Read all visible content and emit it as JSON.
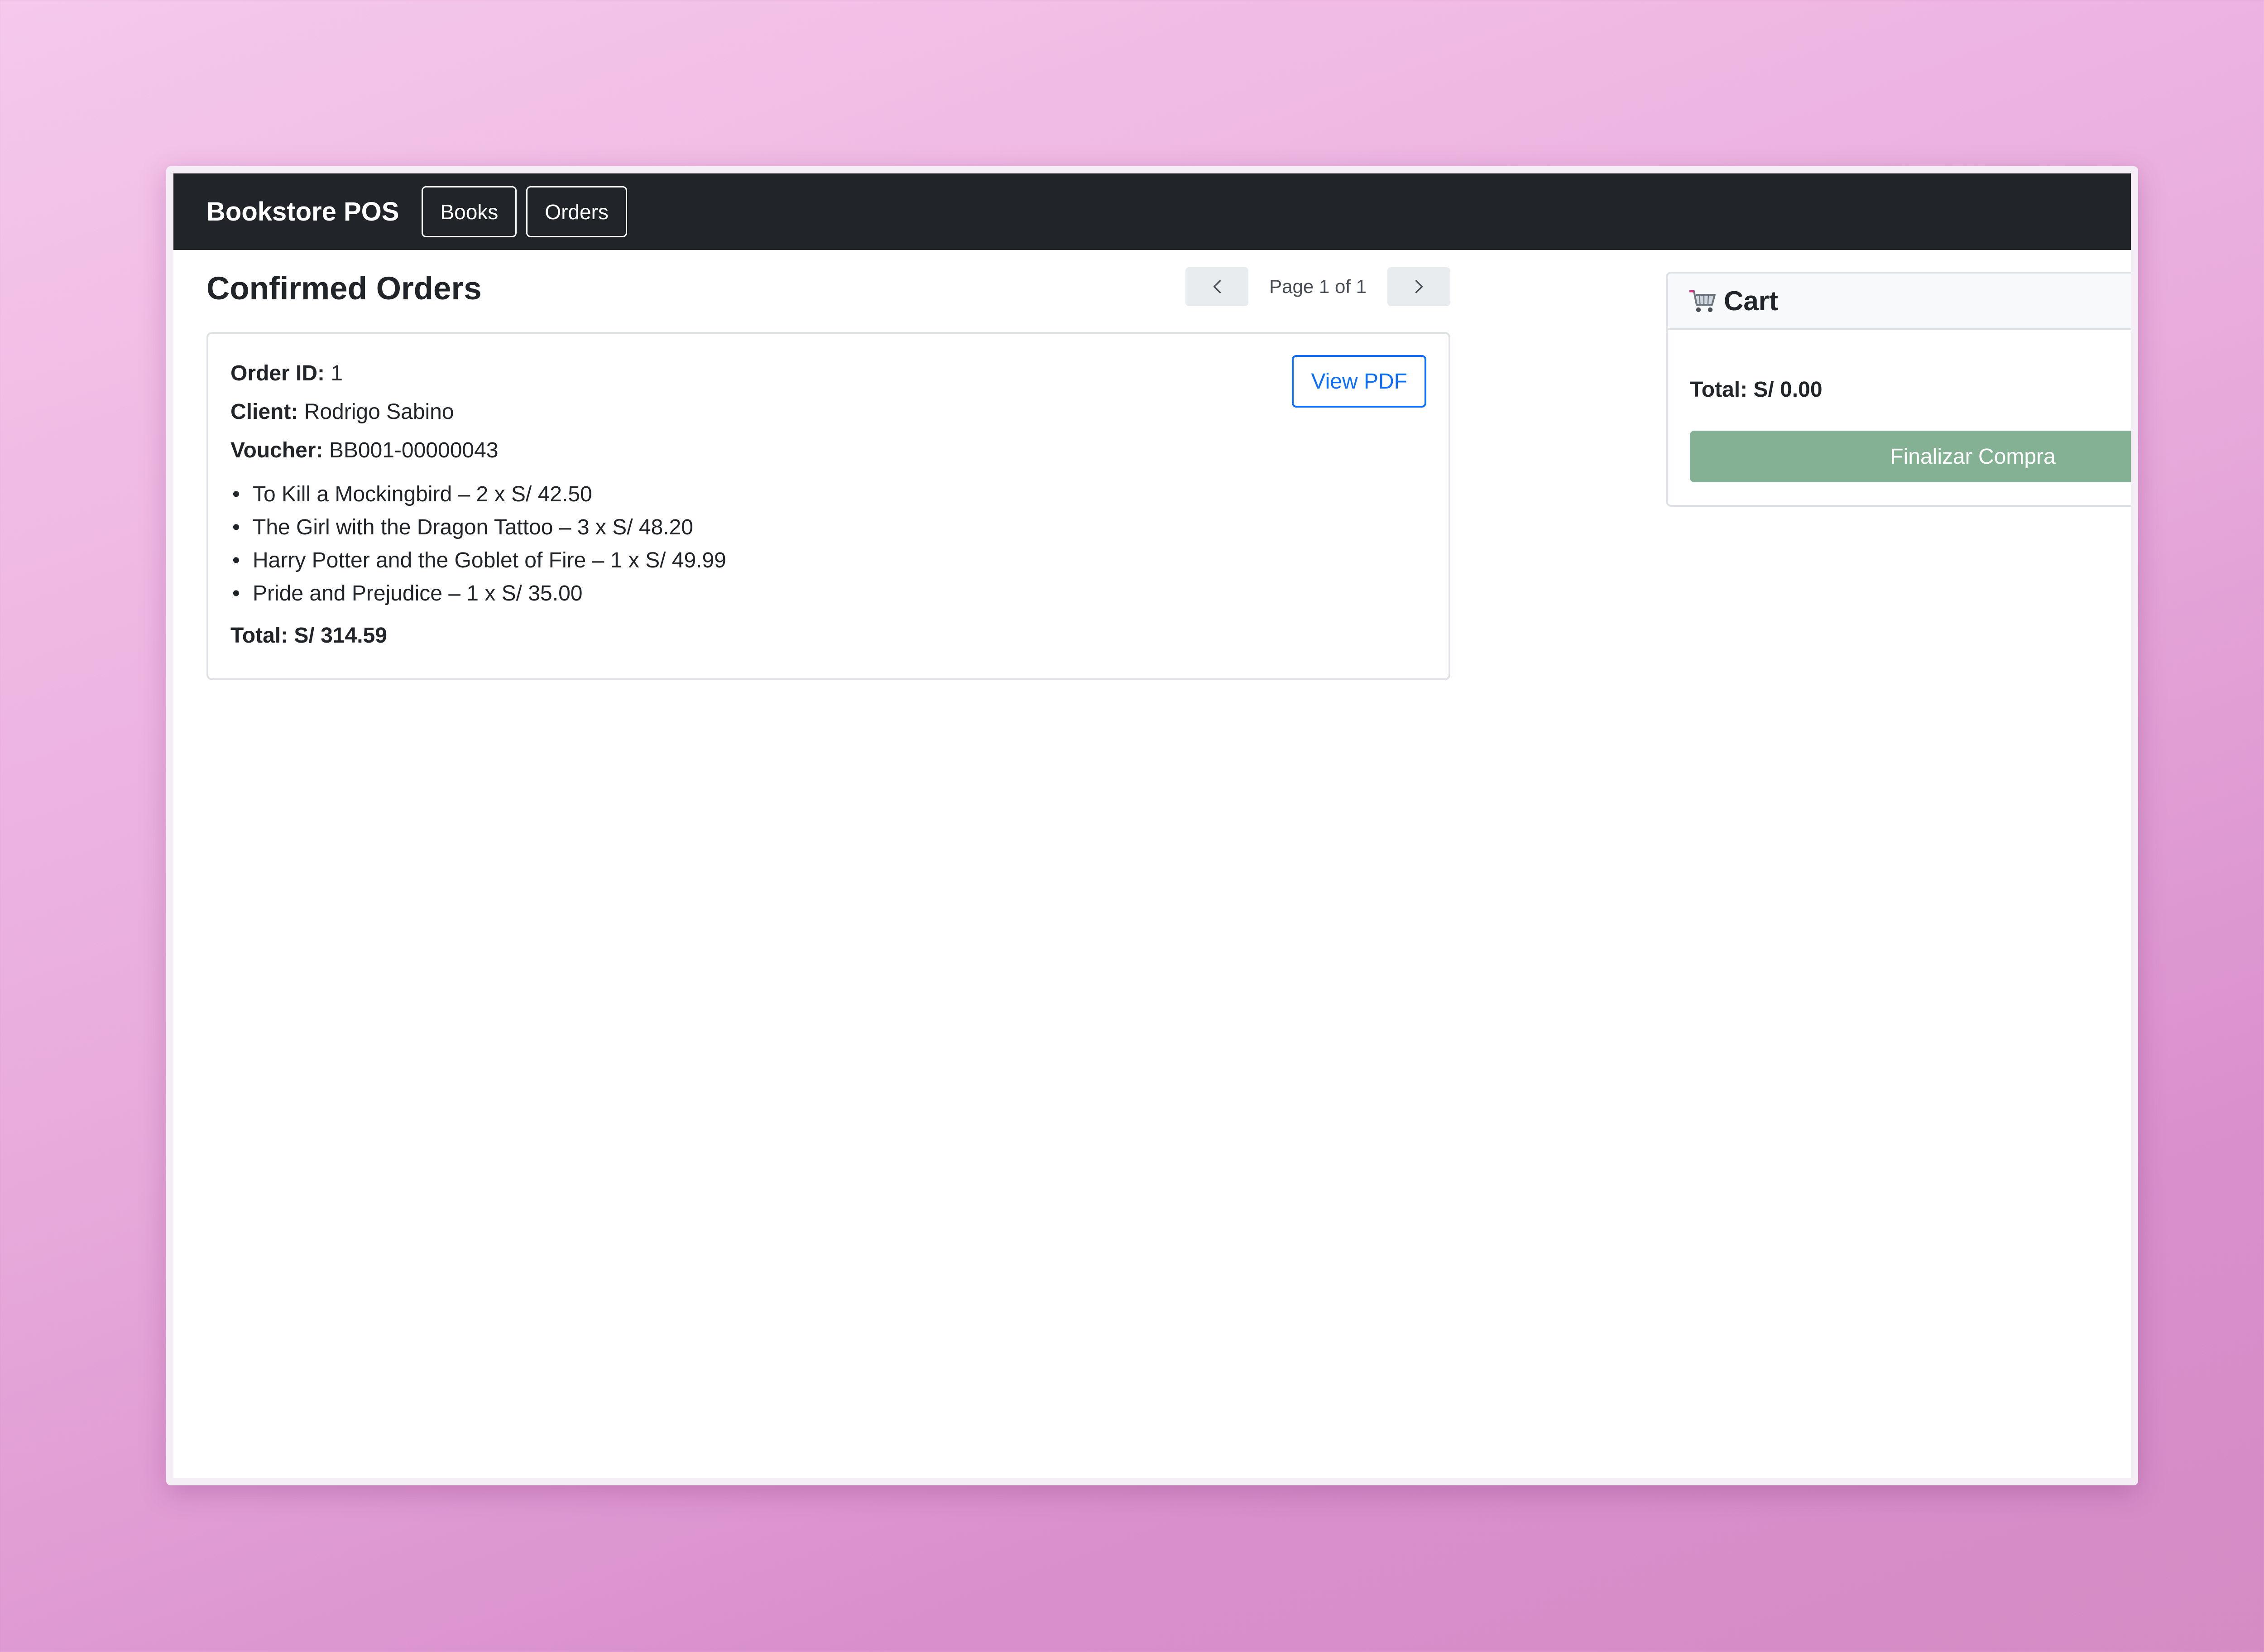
{
  "navbar": {
    "brand": "Bookstore POS",
    "links": [
      {
        "label": "Books"
      },
      {
        "label": "Orders"
      }
    ]
  },
  "orders": {
    "title": "Confirmed Orders",
    "pagination": {
      "prev_icon": "chevron-left-icon",
      "next_icon": "chevron-right-icon",
      "text": "Page 1 of 1"
    },
    "list": [
      {
        "order_id_label": "Order ID:",
        "order_id": "1",
        "client_label": "Client:",
        "client": "Rodrigo Sabino",
        "voucher_label": "Voucher:",
        "voucher": "BB001-00000043",
        "items": [
          "To Kill a Mockingbird – 2 x S/ 42.50",
          "The Girl with the Dragon Tattoo – 3 x S/ 48.20",
          "Harry Potter and the Goblet of Fire – 1 x S/ 49.99",
          "Pride and Prejudice – 1 x S/ 35.00"
        ],
        "total": "Total: S/ 314.59",
        "view_pdf_label": "View PDF"
      }
    ]
  },
  "cart": {
    "icon": "shopping-cart-icon",
    "title": "Cart",
    "total": "Total: S/ 0.00",
    "checkout_label": "Finalizar Compra"
  },
  "colors": {
    "navbar_bg": "#212529",
    "link_blue": "#0d6efd",
    "checkout_green": "#84b193"
  }
}
